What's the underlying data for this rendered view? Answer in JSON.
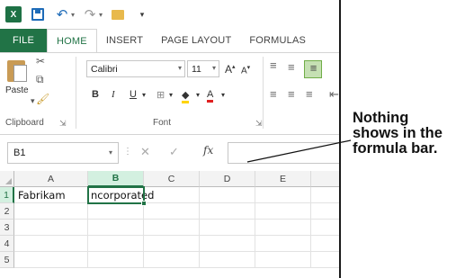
{
  "quick_access": {
    "icons": [
      "excel-icon",
      "save-icon",
      "undo-icon",
      "redo-icon",
      "open-folder-icon",
      "customize-icon"
    ]
  },
  "ribbon_tabs": [
    {
      "label": "FILE"
    },
    {
      "label": "HOME"
    },
    {
      "label": "INSERT"
    },
    {
      "label": "PAGE LAYOUT"
    },
    {
      "label": "FORMULAS"
    }
  ],
  "clipboard": {
    "paste_label": "Paste",
    "group_label": "Clipboard"
  },
  "font": {
    "font_name": "Calibri",
    "font_size": "11",
    "grow_label": "A",
    "shrink_label": "A",
    "bold_label": "B",
    "italic_label": "I",
    "underline_label": "U",
    "group_label": "Font"
  },
  "formula_bar": {
    "name_box": "B1",
    "cancel_glyph": "✕",
    "enter_glyph": "✓",
    "fx_label": "fx",
    "value": ""
  },
  "grid": {
    "columns": [
      "A",
      "B",
      "C",
      "D",
      "E"
    ],
    "rows": [
      "1",
      "2",
      "3",
      "4",
      "5"
    ],
    "cell_a1": "Fabrikam",
    "cell_b1_editing": "ncorporated",
    "active_cell": "B1"
  },
  "callout": {
    "text_line1": "Nothing",
    "text_line2": "shows in the",
    "text_line3": "formula bar."
  },
  "colors": {
    "excel_green": "#217346",
    "selection_highlight": "#d3f0e0"
  }
}
